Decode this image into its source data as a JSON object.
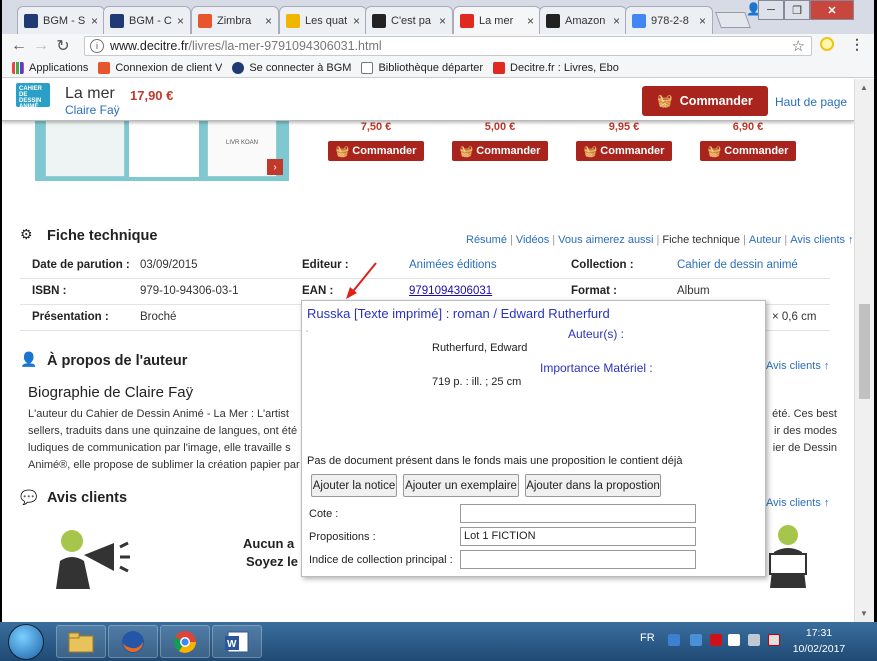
{
  "browser": {
    "tabs": [
      {
        "title": "BGM - S",
        "icon": "bgm-icon",
        "color": "#1f3a74"
      },
      {
        "title": "BGM - C",
        "icon": "bgm-icon",
        "color": "#1f3a74"
      },
      {
        "title": "Zimbra",
        "icon": "zimbra-icon",
        "color": "#e8542b"
      },
      {
        "title": "Les quat",
        "icon": "b-icon",
        "color": "#f1b500"
      },
      {
        "title": "C'est pa",
        "icon": "amazon-icon",
        "color": "#222222"
      },
      {
        "title": "La mer",
        "icon": "decitre-icon",
        "color": "#e02a20"
      },
      {
        "title": "Amazon",
        "icon": "amazon-icon",
        "color": "#222222"
      },
      {
        "title": "978-2-8",
        "icon": "google-icon",
        "color": "#4285f4"
      }
    ],
    "url_host": "www.decitre.fr",
    "url_path": "/livres/la-mer-9791094306031.html",
    "bookmarks": [
      {
        "label": "Applications",
        "icon": "apps-icon"
      },
      {
        "label": "Connexion de client V",
        "icon": "zimbra-icon"
      },
      {
        "label": "Se connecter à BGM",
        "icon": "bgm-icon"
      },
      {
        "label": "Bibliothèque départer",
        "icon": "page-icon"
      },
      {
        "label": "Decitre.fr : Livres, Ebo",
        "icon": "decitre-icon"
      }
    ]
  },
  "sticky": {
    "logo_text": "CAHIER DE DESSIN ANIMÉ",
    "title": "La mer",
    "price": "17,90 €",
    "author": "Claire Faÿ",
    "order_label": "Commander",
    "top_link": "Haut de page"
  },
  "related": {
    "cover_text": "LIVR KOAN",
    "prices": [
      "7,50 €",
      "5,00 €",
      "9,95 €",
      "6,90 €"
    ],
    "order_label": "Commander"
  },
  "tech": {
    "title": "Fiche technique",
    "links": [
      "Résumé",
      "Vidéos",
      "Vous aimerez aussi",
      "Fiche technique",
      "Auteur",
      "Avis clients"
    ],
    "rows": [
      [
        [
          "Date de parution :",
          "03/09/2015"
        ],
        [
          "Editeur :",
          "Animées éditions"
        ],
        [
          "Collection :",
          "Cahier de dessin animé"
        ]
      ],
      [
        [
          "ISBN :",
          "979-10-94306-03-1"
        ],
        [
          "EAN :",
          "9791094306031"
        ],
        [
          "Format :",
          "Album"
        ]
      ],
      [
        [
          "Présentation :",
          "Broché"
        ],
        [
          "",
          ""
        ],
        [
          "",
          "× 0,6 cm"
        ]
      ]
    ]
  },
  "author_section": {
    "title": "À propos de l'auteur",
    "links_tail": "Avis clients",
    "bio_title": "Biographie de Claire Faÿ",
    "bio_lines": [
      "L'auteur du Cahier de Dessin Animé - La Mer :   L'artist",
      "sellers, traduits dans une quinzaine de langues, ont été",
      "ludiques de communication par l'image, elle travaille s",
      "Animé®, elle propose de sublimer la création papier par"
    ],
    "bio_right": [
      "été. Ces best",
      "ir des modes",
      "ier de Dessin"
    ]
  },
  "reviews": {
    "title": "Avis clients",
    "links_tail": "Avis clients",
    "line1": "Aucun a",
    "line2": "Soyez le"
  },
  "popup": {
    "title": "Russka [Texte imprimé] : roman / Edward Rutherfurd",
    "authors_label": "Auteur(s) :",
    "author_value": "Rutherfurd, Edward",
    "material_label": "Importance Matériel :",
    "material_value": "719 p. : ill. ; 25 cm",
    "notice": "Pas de document présent dans le fonds mais une proposition le contient déjà",
    "btn_add_notice": "Ajouter la notice",
    "btn_add_copy": "Ajouter un exemplaire",
    "btn_add_proposal": "Ajouter dans la propostion",
    "cote_label": "Cote :",
    "cote_value": "",
    "propositions_label": "Propositions :",
    "propositions_value": "Lot 1 FICTION",
    "indice_label": "Indice de collection principal :",
    "indice_value": ""
  },
  "taskbar": {
    "lang": "FR",
    "time": "17:31",
    "date": "10/02/2017"
  }
}
